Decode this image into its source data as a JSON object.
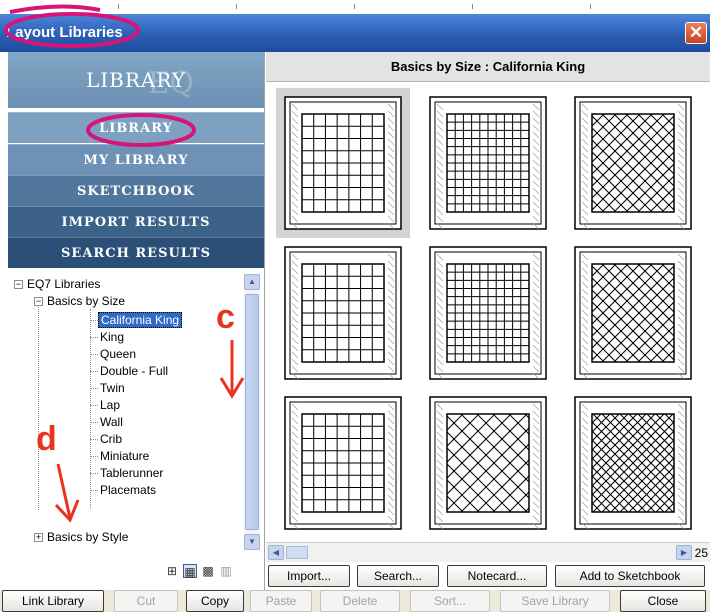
{
  "window": {
    "title": "Layout Libraries",
    "close_glyph": "✕"
  },
  "sidebar": {
    "header": "LIBRARY",
    "watermark": "EQ",
    "nav": [
      {
        "label": "LIBRARY"
      },
      {
        "label": "MY LIBRARY"
      },
      {
        "label": "SKETCHBOOK"
      },
      {
        "label": "IMPORT RESULTS"
      },
      {
        "label": "SEARCH RESULTS"
      }
    ]
  },
  "tree": {
    "root": "EQ7 Libraries",
    "group1": "Basics by Size",
    "items": [
      "California King",
      "King",
      "Queen",
      "Double - Full",
      "Twin",
      "Lap",
      "Wall",
      "Crib",
      "Miniature",
      "Tablerunner",
      "Placemats"
    ],
    "selected": "California King",
    "group2": "Basics by Style"
  },
  "grid": {
    "title": "Basics by Size  :  California King",
    "page": "25",
    "thumbnails": [
      {
        "pattern": "grid-wide",
        "selected": true
      },
      {
        "pattern": "grid-dense",
        "selected": false
      },
      {
        "pattern": "diagonal",
        "selected": false
      },
      {
        "pattern": "grid-wide",
        "selected": false
      },
      {
        "pattern": "grid-dense",
        "selected": false
      },
      {
        "pattern": "diagonal",
        "selected": false
      },
      {
        "pattern": "grid-wide",
        "selected": false
      },
      {
        "pattern": "diagonal-wide",
        "selected": false
      },
      {
        "pattern": "diagonal-dense",
        "selected": false
      }
    ]
  },
  "action_buttons": {
    "import": "Import...",
    "search": "Search...",
    "notecard": "Notecard...",
    "add_sketchbook": "Add to Sketchbook"
  },
  "bottom_buttons": {
    "link_library": "Link Library",
    "cut": "Cut",
    "copy": "Copy",
    "paste": "Paste",
    "delete": "Delete",
    "sort": "Sort...",
    "save_library": "Save Library",
    "close": "Close"
  },
  "view_icons": [
    "view-large-icon",
    "view-medium-icon",
    "view-small-icon",
    "view-list-icon"
  ],
  "annotations": {
    "c": "c",
    "d": "d",
    "color": "#e83320",
    "highlight": "#d6157a"
  }
}
